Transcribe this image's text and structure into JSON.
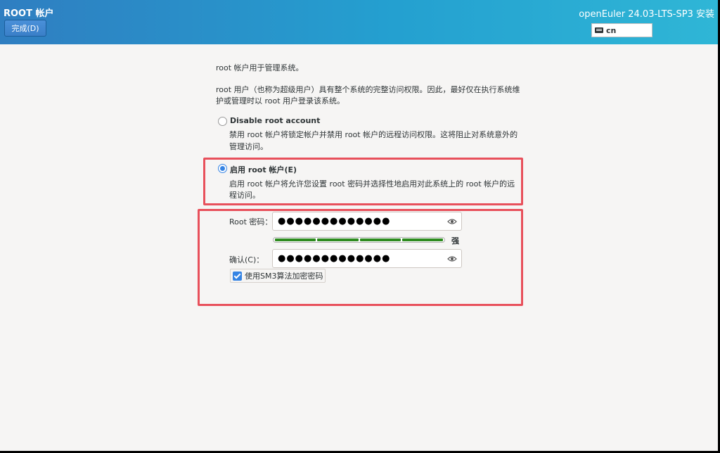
{
  "header": {
    "spoke_title": "ROOT 帐户",
    "done_label": "完成(D)",
    "product_title": "openEuler 24.03-LTS-SP3 安装",
    "keyboard_layout": "cn"
  },
  "intro": {
    "line1": "root 帐户用于管理系统。",
    "line2a": "root 用户（也称为超级用户）具有整个系统的完整访问权限。因此，最好仅在执行系统维",
    "line2b": "护或管理时以 root 用户登录该系统。"
  },
  "options": {
    "disable": {
      "label": "Disable root account",
      "desc_a": "禁用 root 帐户将锁定帐户并禁用 root 帐户的远程访问权限。这将阻止对系统意外的",
      "desc_b": "管理访问。",
      "selected": false
    },
    "enable": {
      "label": "启用 root 帐户(E)",
      "desc_a": "启用 root 帐户将允许您设置 root 密码并选择性地启用对此系统上的 root 帐户的远",
      "desc_b": "程访问。",
      "selected": true
    }
  },
  "password": {
    "label": "Root 密码：",
    "value": "●●●●●●●●●●●●●",
    "strength_label": "强",
    "strength_level": 1.0
  },
  "confirm": {
    "label": "确认(C)：",
    "value": "●●●●●●●●●●●●●"
  },
  "sm3": {
    "label": "使用SM3算法加密密码",
    "checked": true
  },
  "colors": {
    "accent": "#3584e4",
    "highlight": "#e8505b",
    "strength": "#2e8b1f"
  }
}
